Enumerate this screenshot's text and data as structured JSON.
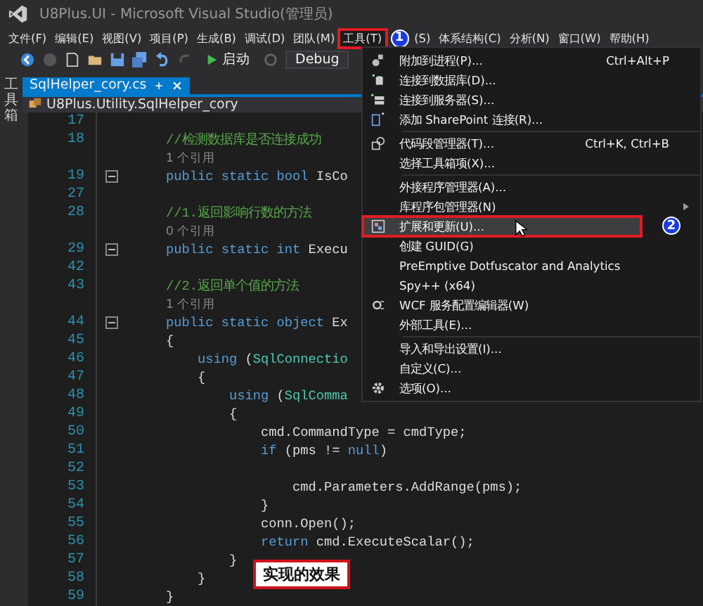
{
  "window": {
    "title": "U8Plus.UI - Microsoft Visual Studio(管理员)"
  },
  "menu_bar": [
    {
      "label": "文件(F)",
      "selected": false
    },
    {
      "label": "编辑(E)",
      "selected": false
    },
    {
      "label": "视图(V)",
      "selected": false
    },
    {
      "label": "项目(P)",
      "selected": false
    },
    {
      "label": "生成(B)",
      "selected": false
    },
    {
      "label": "调试(D)",
      "selected": false
    },
    {
      "label": "团队(M)",
      "selected": false
    },
    {
      "label": "工具(T)",
      "selected": true
    },
    {
      "label": "(S)",
      "selected": false
    },
    {
      "label": "体系结构(C)",
      "selected": false
    },
    {
      "label": "分析(N)",
      "selected": false
    },
    {
      "label": "窗口(W)",
      "selected": false
    },
    {
      "label": "帮助(H)",
      "selected": false
    }
  ],
  "toolbar": {
    "start_label": "启动",
    "configuration": "Debug"
  },
  "side_strip": {
    "label": "工具箱"
  },
  "tab": {
    "label": "SqlHelper_cory.cs",
    "selected": true
  },
  "navigation_bar": {
    "label": "U8Plus.Utility.SqlHelper_cory"
  },
  "code_lines": [
    {
      "number": "17",
      "fold": false
    },
    {
      "number": "18",
      "fold": false,
      "tokens": [
        {
          "text": "//检测数据库是否连接成功",
          "kind": "comment"
        }
      ]
    },
    {
      "fold": false,
      "tokens": [
        {
          "text": "1 个引用",
          "kind": "ref"
        }
      ]
    },
    {
      "number": "19",
      "fold": true,
      "tokens": [
        {
          "text": "public static bool ",
          "kind": "keyword"
        },
        {
          "text": "IsCo",
          "kind": "plain"
        }
      ]
    },
    {
      "number": "27",
      "fold": false
    },
    {
      "number": "28",
      "fold": false,
      "tokens": [
        {
          "text": "//1.返回影响行数的方法",
          "kind": "comment"
        }
      ]
    },
    {
      "fold": false,
      "tokens": [
        {
          "text": "0 个引用",
          "kind": "ref"
        }
      ]
    },
    {
      "number": "29",
      "fold": true,
      "tokens": [
        {
          "text": "public static int ",
          "kind": "keyword"
        },
        {
          "text": "Execu",
          "kind": "plain"
        }
      ]
    },
    {
      "number": "42",
      "fold": false
    },
    {
      "number": "43",
      "fold": false,
      "tokens": [
        {
          "text": "//2.返回单个值的方法",
          "kind": "comment"
        }
      ]
    },
    {
      "fold": false,
      "tokens": [
        {
          "text": "1 个引用",
          "kind": "ref"
        }
      ]
    },
    {
      "number": "44",
      "fold": true,
      "tokens": [
        {
          "text": "public static object ",
          "kind": "keyword"
        },
        {
          "text": "Ex",
          "kind": "plain"
        }
      ]
    },
    {
      "number": "45",
      "fold": false,
      "tokens": [
        {
          "text": "{",
          "kind": "plain"
        }
      ]
    },
    {
      "number": "46",
      "fold": false,
      "tokens": [
        {
          "text": "    using ",
          "kind": "keyword"
        },
        {
          "text": "(",
          "kind": "plain"
        },
        {
          "text": "SqlConnectio",
          "kind": "type"
        }
      ]
    },
    {
      "number": "47",
      "fold": false,
      "tokens": [
        {
          "text": "    {",
          "kind": "plain"
        }
      ]
    },
    {
      "number": "48",
      "fold": false,
      "tokens": [
        {
          "text": "        using ",
          "kind": "keyword"
        },
        {
          "text": "(",
          "kind": "plain"
        },
        {
          "text": "SqlComma",
          "kind": "type"
        }
      ]
    },
    {
      "number": "49",
      "fold": false,
      "tokens": [
        {
          "text": "        {",
          "kind": "plain"
        }
      ]
    },
    {
      "number": "50",
      "fold": false,
      "tokens": [
        {
          "text": "            cmd.CommandType = cmdType;",
          "kind": "plain"
        }
      ]
    },
    {
      "number": "51",
      "fold": false,
      "tokens": [
        {
          "text": "            if ",
          "kind": "keyword"
        },
        {
          "text": "(pms != ",
          "kind": "plain"
        },
        {
          "text": "null",
          "kind": "keyword"
        },
        {
          "text": ")",
          "kind": "plain"
        }
      ]
    },
    {
      "number": "52",
      "fold": false
    },
    {
      "number": "53",
      "fold": false,
      "tokens": [
        {
          "text": "                cmd.Parameters.AddRange(pms);",
          "kind": "plain"
        }
      ]
    },
    {
      "number": "54",
      "fold": false,
      "tokens": [
        {
          "text": "            }",
          "kind": "plain"
        }
      ]
    },
    {
      "number": "55",
      "fold": false,
      "tokens": [
        {
          "text": "            conn.Open();",
          "kind": "plain"
        }
      ]
    },
    {
      "number": "56",
      "fold": false,
      "tokens": [
        {
          "text": "            return ",
          "kind": "keyword"
        },
        {
          "text": "cmd.ExecuteScalar();",
          "kind": "plain"
        }
      ]
    },
    {
      "number": "57",
      "fold": false,
      "tokens": [
        {
          "text": "        }",
          "kind": "plain"
        }
      ]
    },
    {
      "number": "58",
      "fold": false,
      "tokens": [
        {
          "text": "    }",
          "kind": "plain"
        }
      ]
    },
    {
      "number": "59",
      "fold": false,
      "tokens": [
        {
          "text": "}",
          "kind": "plain"
        }
      ]
    }
  ],
  "tools_menu": [
    {
      "label": "附加到进程(P)...",
      "shortcut": "Ctrl+Alt+P",
      "separator_before": false,
      "submenu": false,
      "selected": false
    },
    {
      "label": "连接到数据库(D)...",
      "separator_before": false,
      "submenu": false,
      "selected": false
    },
    {
      "label": "连接到服务器(S)...",
      "separator_before": false,
      "submenu": false,
      "selected": false
    },
    {
      "label": "添加 SharePoint 连接(R)...",
      "separator_before": false,
      "submenu": false,
      "selected": false
    },
    {
      "label": "代码段管理器(T)...",
      "shortcut": "Ctrl+K, Ctrl+B",
      "separator_before": true,
      "submenu": false,
      "selected": false
    },
    {
      "label": "选择工具箱项(X)...",
      "separator_before": false,
      "submenu": false,
      "selected": false
    },
    {
      "label": "外接程序管理器(A)...",
      "separator_before": true,
      "submenu": false,
      "selected": false
    },
    {
      "label": "库程序包管理器(N)",
      "separator_before": false,
      "submenu": true,
      "selected": false
    },
    {
      "label": "扩展和更新(U)...",
      "separator_before": false,
      "submenu": false,
      "selected": true
    },
    {
      "label": "创建 GUID(G)",
      "separator_before": false,
      "submenu": false,
      "selected": false
    },
    {
      "label": "PreEmptive Dotfuscator and Analytics",
      "separator_before": false,
      "submenu": false,
      "selected": false
    },
    {
      "label": "Spy++ (x64)",
      "separator_before": false,
      "submenu": false,
      "selected": false
    },
    {
      "label": "WCF 服务配置编辑器(W)",
      "separator_before": false,
      "submenu": false,
      "selected": false
    },
    {
      "label": "外部工具(E)...",
      "separator_before": false,
      "submenu": false,
      "selected": false
    },
    {
      "label": "导入和导出设置(I)...",
      "separator_before": true,
      "submenu": false,
      "selected": false
    },
    {
      "label": "自定义(C)...",
      "separator_before": false,
      "submenu": false,
      "selected": false
    },
    {
      "label": "选项(O)...",
      "separator_before": false,
      "submenu": false,
      "selected": false
    }
  ],
  "step_markers": [
    {
      "number": "1"
    },
    {
      "number": "2"
    }
  ],
  "callout": {
    "text": "实现的效果"
  }
}
